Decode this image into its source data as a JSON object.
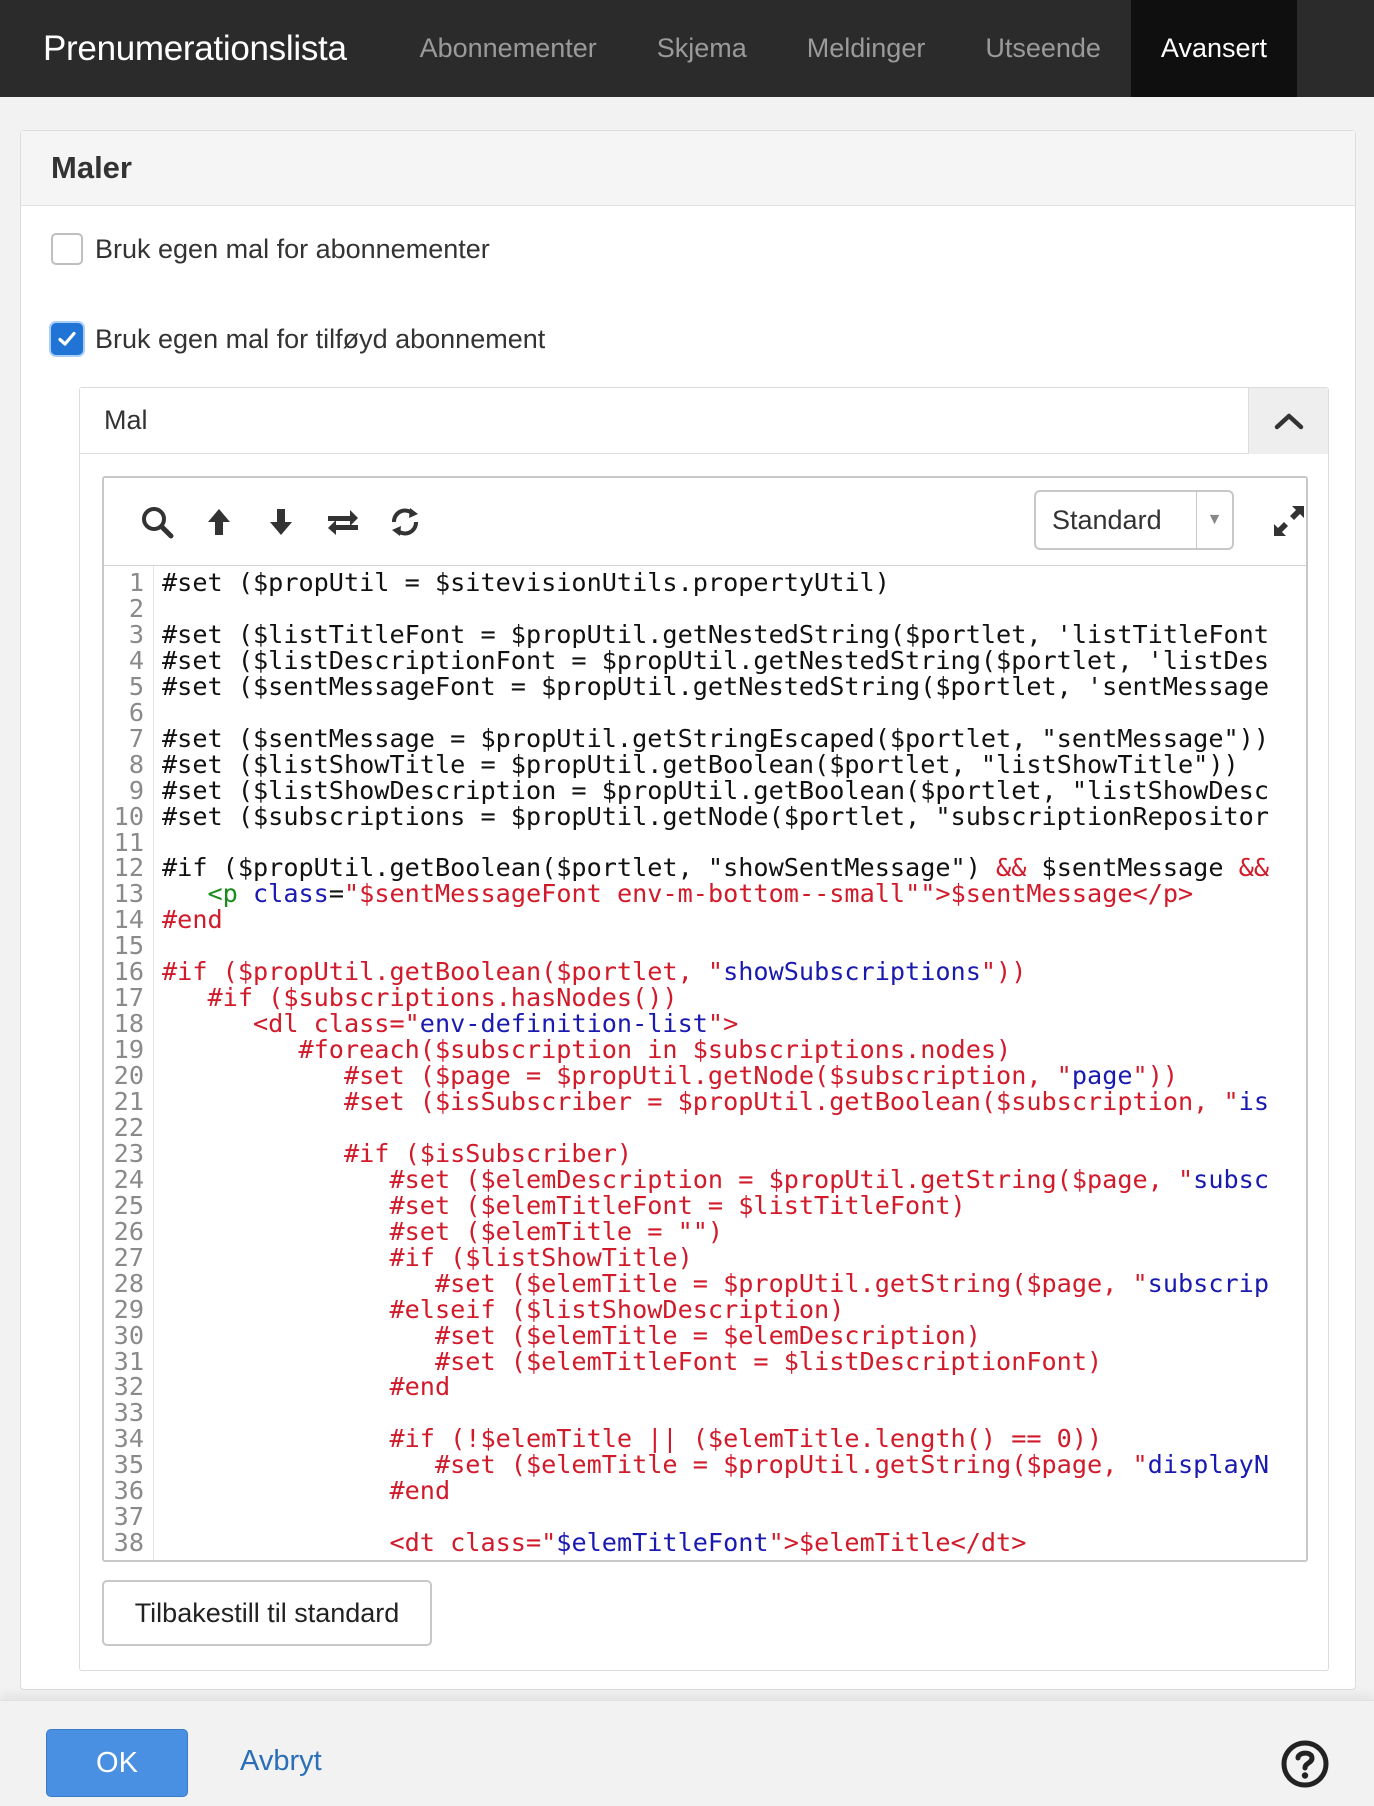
{
  "nav": {
    "brand": "Prenumerationslista",
    "tabs": [
      {
        "label": "Abonnementer",
        "active": false
      },
      {
        "label": "Skjema",
        "active": false
      },
      {
        "label": "Meldinger",
        "active": false
      },
      {
        "label": "Utseende",
        "active": false
      },
      {
        "label": "Avansert",
        "active": true
      }
    ]
  },
  "panel": {
    "title": "Maler",
    "checkbox1": {
      "label": "Bruk egen mal for abonnementer",
      "checked": false
    },
    "checkbox2": {
      "label": "Bruk egen mal for tilføyd abonnement",
      "checked": true
    },
    "template": {
      "title": "Mal",
      "select_value": "Standard",
      "reset_label": "Tilbakestill til standard"
    }
  },
  "code_lines": [
    {
      "n": "1",
      "parts": [
        [
          "blk",
          "#set ($propUtil = $sitevisionUtils.propertyUtil)"
        ]
      ]
    },
    {
      "n": "2",
      "parts": []
    },
    {
      "n": "3",
      "parts": [
        [
          "blk",
          "#set ($listTitleFont = $propUtil.getNestedString($portlet, 'listTitleFont"
        ]
      ]
    },
    {
      "n": "4",
      "parts": [
        [
          "blk",
          "#set ($listDescriptionFont = $propUtil.getNestedString($portlet, 'listDes"
        ]
      ]
    },
    {
      "n": "5",
      "parts": [
        [
          "blk",
          "#set ($sentMessageFont = $propUtil.getNestedString($portlet, 'sentMessage"
        ]
      ]
    },
    {
      "n": "6",
      "parts": []
    },
    {
      "n": "7",
      "parts": [
        [
          "blk",
          "#set ($sentMessage = $propUtil.getStringEscaped($portlet, \"sentMessage\"))"
        ]
      ]
    },
    {
      "n": "8",
      "parts": [
        [
          "blk",
          "#set ($listShowTitle = $propUtil.getBoolean($portlet, \"listShowTitle\"))"
        ]
      ]
    },
    {
      "n": "9",
      "parts": [
        [
          "blk",
          "#set ($listShowDescription = $propUtil.getBoolean($portlet, \"listShowDesc"
        ]
      ]
    },
    {
      "n": "10",
      "parts": [
        [
          "blk",
          "#set ($subscriptions = $propUtil.getNode($portlet, \"subscriptionRepositor"
        ]
      ]
    },
    {
      "n": "11",
      "parts": []
    },
    {
      "n": "12",
      "parts": [
        [
          "blk",
          "#if ($propUtil.getBoolean($portlet, \"showSentMessage\") "
        ],
        [
          "dir",
          "&&"
        ],
        [
          "blk",
          " $sentMessage "
        ],
        [
          "dir",
          "&&"
        ]
      ]
    },
    {
      "n": "13",
      "parts": [
        [
          "blk",
          "   "
        ],
        [
          "tag",
          "<p"
        ],
        [
          "blk",
          " "
        ],
        [
          "attr",
          "class"
        ],
        [
          "blk",
          "="
        ],
        [
          "dir",
          "\"$sentMessageFont env-m-bottom--small\"\">$sentMessage</p>"
        ]
      ]
    },
    {
      "n": "14",
      "parts": [
        [
          "dir",
          "#end"
        ]
      ]
    },
    {
      "n": "15",
      "parts": []
    },
    {
      "n": "16",
      "parts": [
        [
          "dir",
          "#if ($propUtil.getBoolean($portlet, \""
        ],
        [
          "str",
          "showSubscriptions"
        ],
        [
          "dir",
          "\"))"
        ]
      ]
    },
    {
      "n": "17",
      "parts": [
        [
          "dir",
          "   #if ($subscriptions.hasNodes())"
        ]
      ]
    },
    {
      "n": "18",
      "parts": [
        [
          "dir",
          "      <dl class=\""
        ],
        [
          "str",
          "env-definition-list"
        ],
        [
          "dir",
          "\">"
        ]
      ]
    },
    {
      "n": "19",
      "parts": [
        [
          "dir",
          "         #foreach($subscription in $subscriptions.nodes)"
        ]
      ]
    },
    {
      "n": "20",
      "parts": [
        [
          "dir",
          "            #set ($page = $propUtil.getNode($subscription, \""
        ],
        [
          "str",
          "page"
        ],
        [
          "dir",
          "\"))"
        ]
      ]
    },
    {
      "n": "21",
      "parts": [
        [
          "dir",
          "            #set ($isSubscriber = $propUtil.getBoolean($subscription, \""
        ],
        [
          "str",
          "is"
        ]
      ]
    },
    {
      "n": "22",
      "parts": []
    },
    {
      "n": "23",
      "parts": [
        [
          "dir",
          "            #if ($isSubscriber)"
        ]
      ]
    },
    {
      "n": "24",
      "parts": [
        [
          "dir",
          "               #set ($elemDescription = $propUtil.getString($page, \""
        ],
        [
          "str",
          "subsc"
        ]
      ]
    },
    {
      "n": "25",
      "parts": [
        [
          "dir",
          "               #set ($elemTitleFont = $listTitleFont)"
        ]
      ]
    },
    {
      "n": "26",
      "parts": [
        [
          "dir",
          "               #set ($elemTitle = \"\")"
        ]
      ]
    },
    {
      "n": "27",
      "parts": [
        [
          "dir",
          "               #if ($listShowTitle)"
        ]
      ]
    },
    {
      "n": "28",
      "parts": [
        [
          "dir",
          "                  #set ($elemTitle = $propUtil.getString($page, \""
        ],
        [
          "str",
          "subscrip"
        ]
      ]
    },
    {
      "n": "29",
      "parts": [
        [
          "dir",
          "               #elseif ($listShowDescription)"
        ]
      ]
    },
    {
      "n": "30",
      "parts": [
        [
          "dir",
          "                  #set ($elemTitle = $elemDescription)"
        ]
      ]
    },
    {
      "n": "31",
      "parts": [
        [
          "dir",
          "                  #set ($elemTitleFont = $listDescriptionFont)"
        ]
      ]
    },
    {
      "n": "32",
      "parts": [
        [
          "dir",
          "               #end"
        ]
      ]
    },
    {
      "n": "33",
      "parts": []
    },
    {
      "n": "34",
      "parts": [
        [
          "dir",
          "               #if (!$elemTitle || ($elemTitle.length() == 0))"
        ]
      ]
    },
    {
      "n": "35",
      "parts": [
        [
          "dir",
          "                  #set ($elemTitle = $propUtil.getString($page, \""
        ],
        [
          "str",
          "displayN"
        ]
      ]
    },
    {
      "n": "36",
      "parts": [
        [
          "dir",
          "               #end"
        ]
      ]
    },
    {
      "n": "37",
      "parts": []
    },
    {
      "n": "38",
      "parts": [
        [
          "dir",
          "               <dt class=\""
        ],
        [
          "str",
          "$elemTitleFont"
        ],
        [
          "dir",
          "\">$elemTitle</dt>"
        ]
      ]
    }
  ],
  "footer": {
    "ok_label": "OK",
    "cancel_label": "Avbryt"
  },
  "icons": {
    "toolbar": [
      "search-icon",
      "arrow-up-icon",
      "arrow-down-icon",
      "swap-icon",
      "refresh-icon"
    ],
    "expand": "expand-icon",
    "collapse": "chevron-up-icon",
    "help": "help-icon",
    "check": "checkmark-icon"
  },
  "colors": {
    "nav_bg": "#2b2b2b",
    "accent": "#1f74d6",
    "ok_button": "#4a90e2",
    "code_directive": "#d11a2a",
    "code_string": "#1a1ab0",
    "code_tag": "#1a8a1a"
  }
}
